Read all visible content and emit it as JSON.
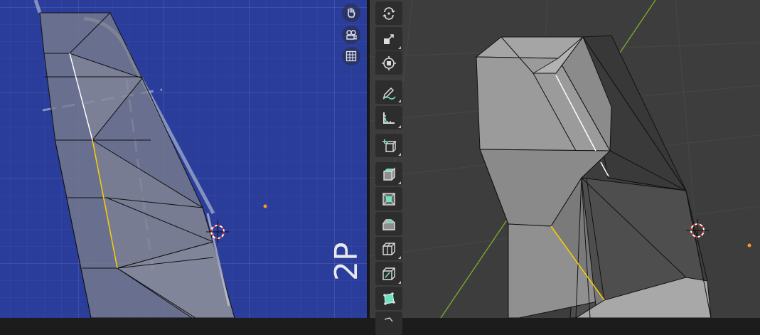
{
  "left_viewport": {
    "view_label": "2P",
    "nav_buttons": [
      {
        "name": "hand-pan-icon"
      },
      {
        "name": "camera-view-icon"
      },
      {
        "name": "grid-toggle-icon"
      }
    ]
  },
  "toolbar": {
    "tools": [
      {
        "name": "rotate-tool-icon"
      },
      {
        "name": "scale-tool-icon"
      },
      {
        "name": "transform-tool-icon"
      },
      {
        "name": "annotate-tool-icon"
      },
      {
        "name": "measure-tool-icon"
      },
      {
        "name": "add-cube-tool-icon"
      },
      {
        "name": "extrude-region-tool-icon"
      },
      {
        "name": "inset-faces-tool-icon"
      },
      {
        "name": "bevel-tool-icon"
      },
      {
        "name": "loop-cut-tool-icon"
      },
      {
        "name": "knife-tool-icon"
      },
      {
        "name": "poly-build-tool-icon"
      },
      {
        "name": "spin-tool-icon"
      }
    ]
  },
  "colors": {
    "left_bg": "#2b3d9b",
    "right_bg": "#3d3d3d",
    "edge_selected": "#ffd000",
    "edge_active": "#ffffff",
    "cursor_red": "#e03030",
    "origin_orange": "#ff9a20",
    "axis_green": "#7aa82b",
    "tool_icon": "#dcdcdc",
    "tool_accent": "#6fe0c0"
  }
}
